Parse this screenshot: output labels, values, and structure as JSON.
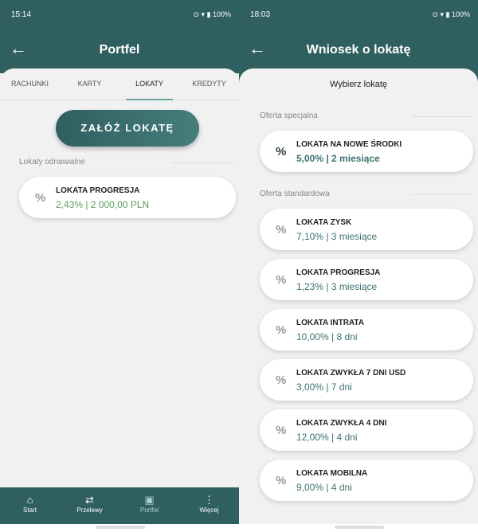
{
  "left": {
    "status_time": "15:14",
    "status_icons": "⊙ ▾ ▮ 100%",
    "title": "Portfel",
    "tabs": [
      "RACHUNKI",
      "KARTY",
      "LOKATY",
      "KREDYTY"
    ],
    "cta_label": "ZAŁÓŻ LOKATĘ",
    "section_label": "Lokaty odnawialne",
    "deposit": {
      "name": "LOKATA PROGRESJA",
      "detail": "2,43% | 2 000,00 PLN"
    },
    "nav": [
      {
        "icon": "⌂",
        "label": "Start"
      },
      {
        "icon": "⇄",
        "label": "Przelewy"
      },
      {
        "icon": "▣",
        "label": "Portfel"
      },
      {
        "icon": "⋮",
        "label": "Więcej"
      }
    ]
  },
  "right": {
    "status_time": "18:03",
    "status_icons": "⊙ ▾ ▮ 100%",
    "title": "Wniosek o lokatę",
    "header": "Wybierz lokatę",
    "special_label": "Oferta specjalna",
    "special_offer": {
      "name": "LOKATA NA NOWE ŚRODKI",
      "detail": "5,00% | 2 miesiące"
    },
    "standard_label": "Oferta standardowa",
    "offers": [
      {
        "name": "LOKATA ZYSK",
        "detail": "7,10% | 3 miesiące"
      },
      {
        "name": "LOKATA PROGRESJA",
        "detail": "1,23% | 3 miesiące"
      },
      {
        "name": "LOKATA INTRATA",
        "detail": "10,00% | 8 dni"
      },
      {
        "name": "LOKATA ZWYKŁA 7 DNI USD",
        "detail": "3,00% | 7 dni"
      },
      {
        "name": "LOKATA ZWYKŁA 4 DNI",
        "detail": "12,00% | 4 dni"
      },
      {
        "name": "LOKATA MOBILNA",
        "detail": "9,00% | 4 dni"
      }
    ]
  },
  "percent_glyph": "%"
}
